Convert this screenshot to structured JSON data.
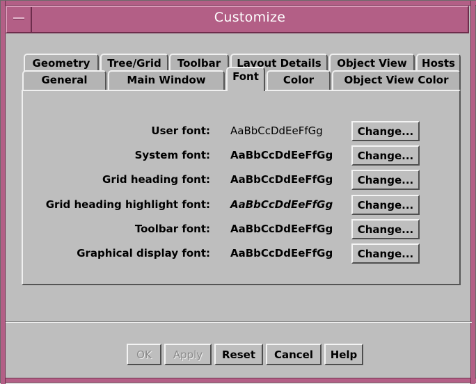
{
  "window": {
    "title": "Customize"
  },
  "tabs": {
    "back": [
      {
        "label": "Geometry"
      },
      {
        "label": "Tree/Grid"
      },
      {
        "label": "Toolbar"
      },
      {
        "label": "Layout Details"
      },
      {
        "label": "Object View"
      },
      {
        "label": "Hosts"
      }
    ],
    "front": [
      {
        "label": "General"
      },
      {
        "label": "Main Window"
      },
      {
        "label": "Font"
      },
      {
        "label": "Color"
      },
      {
        "label": "Object View Color"
      }
    ],
    "active": "Font"
  },
  "fonts": [
    {
      "label": "User font:",
      "sample": "AaBbCcDdEeFfGg",
      "button": "Change..."
    },
    {
      "label": "System font:",
      "sample": "AaBbCcDdEeFfGg",
      "button": "Change..."
    },
    {
      "label": "Grid heading font:",
      "sample": "AaBbCcDdEeFfGg",
      "button": "Change..."
    },
    {
      "label": "Grid heading highlight font:",
      "sample": "AaBbCcDdEeFfGg",
      "button": "Change..."
    },
    {
      "label": "Toolbar font:",
      "sample": "AaBbCcDdEeFfGg",
      "button": "Change..."
    },
    {
      "label": "Graphical display font:",
      "sample": "AaBbCcDdEeFfGg",
      "button": "Change..."
    }
  ],
  "buttons": {
    "ok": "OK",
    "apply": "Apply",
    "reset": "Reset",
    "cancel": "Cancel",
    "help": "Help"
  },
  "colors": {
    "titlebar": "#b35f86",
    "dialog": "#bebebe"
  }
}
